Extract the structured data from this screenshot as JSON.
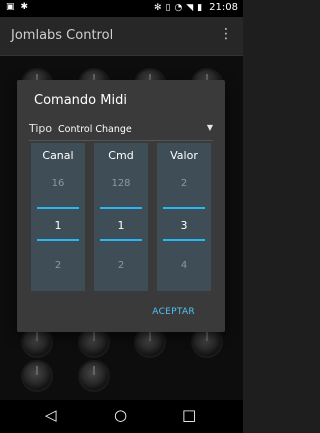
{
  "status_bar": {
    "left_icons": [
      "image-icon",
      "android-icon"
    ],
    "right_icons": [
      "bluetooth-icon",
      "vibrate-icon",
      "signal-icon",
      "wifi-icon",
      "battery-icon"
    ],
    "time": "21:08"
  },
  "app_bar": {
    "title": "Jomlabs Control",
    "menu_icon": "overflow-menu-icon"
  },
  "dialog": {
    "title": "Comando Midi",
    "tipo_label": "Tipo",
    "tipo_value": "Control Change",
    "columns": [
      {
        "header": "Canal",
        "prev": "16",
        "current": "1",
        "next": "2"
      },
      {
        "header": "Cmd",
        "prev": "128",
        "current": "1",
        "next": "2"
      },
      {
        "header": "Valor",
        "prev": "2",
        "current": "3",
        "next": "4"
      }
    ],
    "accept_label": "ACEPTAR"
  },
  "nav_bar": {
    "back": "back-icon",
    "home": "home-icon",
    "recents": "recents-icon"
  },
  "colors": {
    "accent": "#29b6f6",
    "dialog_bg": "#3a3a3a",
    "picker_bg": "#3f4e56"
  }
}
